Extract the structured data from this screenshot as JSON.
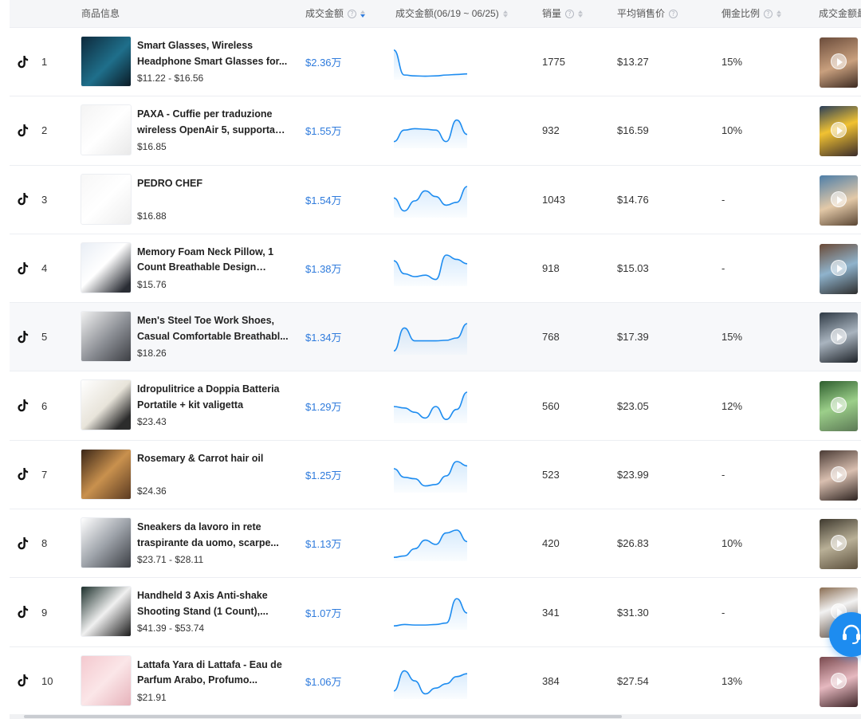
{
  "header": {
    "product_info": "商品信息",
    "amount": "成交金额",
    "trend": "成交金额(06/19 ~ 06/25)",
    "sales": "销量",
    "avg_price": "平均销售价",
    "commission": "佣金比例",
    "top_video": "成交金额最"
  },
  "icons": {
    "platform": "tiktok-icon",
    "question": "question-circle-icon",
    "sort": "sort-icon",
    "play": "play-icon",
    "support": "customer-service-icon"
  },
  "colors": {
    "accent": "#2f7bdc",
    "spark_line": "#1d8cf0",
    "float_button": "#1d8cf0"
  },
  "rows": [
    {
      "rank": "1",
      "title": "Smart Glasses, Wireless Headphone Smart Glasses for...",
      "price": "$11.22 - $16.56",
      "amount": "$2.36万",
      "sales": "1775",
      "avg_price": "$13.27",
      "commission": "15%",
      "trend": [
        0.95,
        0.08,
        0.05,
        0.04,
        0.05,
        0.08,
        0.1,
        0.12
      ]
    },
    {
      "rank": "2",
      "title": "PAXA - Cuffie per traduzione wireless OpenAir 5, supporta l...",
      "price": "$16.85",
      "amount": "$1.55万",
      "sales": "932",
      "avg_price": "$16.59",
      "commission": "10%",
      "trend": [
        0.15,
        0.55,
        0.6,
        0.58,
        0.55,
        0.15,
        0.9,
        0.4
      ]
    },
    {
      "rank": "3",
      "title": "PEDRO CHEF",
      "price": "$16.88",
      "amount": "$1.54万",
      "sales": "1043",
      "avg_price": "$14.76",
      "commission": "-",
      "trend": [
        0.6,
        0.15,
        0.5,
        0.85,
        0.65,
        0.35,
        0.45,
        1.0
      ]
    },
    {
      "rank": "4",
      "title": "Memory Foam Neck Pillow, 1 Count Breathable Design Neck...",
      "price": "$15.76",
      "amount": "$1.38万",
      "sales": "918",
      "avg_price": "$15.03",
      "commission": "-",
      "trend": [
        0.8,
        0.35,
        0.25,
        0.3,
        0.15,
        1.0,
        0.85,
        0.7
      ]
    },
    {
      "rank": "5",
      "title": "Men's Steel Toe Work Shoes, Casual Comfortable Breathabl...",
      "price": "$18.26",
      "amount": "$1.34万",
      "sales": "768",
      "avg_price": "$17.39",
      "commission": "15%",
      "trend": [
        0.05,
        0.85,
        0.4,
        0.4,
        0.4,
        0.42,
        0.5,
        1.0
      ]
    },
    {
      "rank": "6",
      "title": "Idropulitrice a Doppia Batteria Portatile + kit valigetta",
      "price": "$23.43",
      "amount": "$1.29万",
      "sales": "560",
      "avg_price": "$23.05",
      "commission": "12%",
      "trend": [
        0.5,
        0.45,
        0.3,
        0.1,
        0.5,
        0.05,
        0.4,
        1.0
      ]
    },
    {
      "rank": "7",
      "title": "Rosemary & Carrot hair oil",
      "price": "$24.36",
      "amount": "$1.25万",
      "sales": "523",
      "avg_price": "$23.99",
      "commission": "-",
      "trend": [
        0.75,
        0.45,
        0.4,
        0.15,
        0.2,
        0.5,
        1.0,
        0.85
      ]
    },
    {
      "rank": "8",
      "title": "Sneakers da lavoro in rete traspirante da uomo, scarpe...",
      "price": "$23.71 - $28.11",
      "amount": "$1.13万",
      "sales": "420",
      "avg_price": "$26.83",
      "commission": "10%",
      "trend": [
        0.05,
        0.1,
        0.35,
        0.65,
        0.5,
        0.9,
        1.0,
        0.6
      ]
    },
    {
      "rank": "9",
      "title": "Handheld 3 Axis Anti-shake Shooting Stand (1 Count),...",
      "price": "$41.39 - $53.74",
      "amount": "$1.07万",
      "sales": "341",
      "avg_price": "$31.30",
      "commission": "-",
      "trend": [
        0.05,
        0.1,
        0.08,
        0.08,
        0.1,
        0.15,
        1.0,
        0.5
      ]
    },
    {
      "rank": "10",
      "title": "Lattafa Yara di Lattafa - Eau de Parfum Arabo, Profumo...",
      "price": "$21.91",
      "amount": "$1.06万",
      "sales": "384",
      "avg_price": "$27.54",
      "commission": "13%",
      "trend": [
        0.2,
        0.9,
        0.55,
        0.1,
        0.3,
        0.45,
        0.7,
        0.8
      ]
    }
  ]
}
